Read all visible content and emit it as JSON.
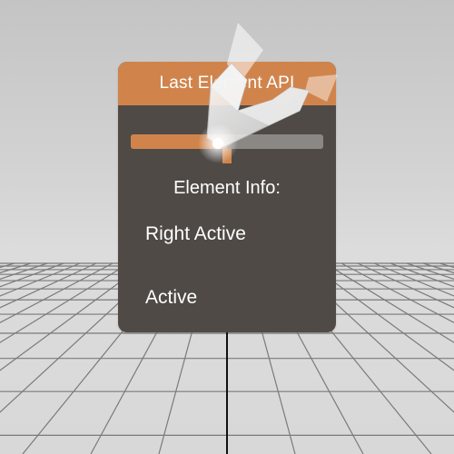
{
  "panel": {
    "title": "Last Element API",
    "slider_value": 0.5,
    "accent_color": "#d0844c",
    "background_color": "#4f4a46"
  },
  "info": {
    "heading": "Element Info:",
    "right_status": "Right Active",
    "left_status": "Active"
  },
  "scene": {
    "controller_icon": "vr-controller-icon",
    "pointer_ray_color": "#111111"
  }
}
